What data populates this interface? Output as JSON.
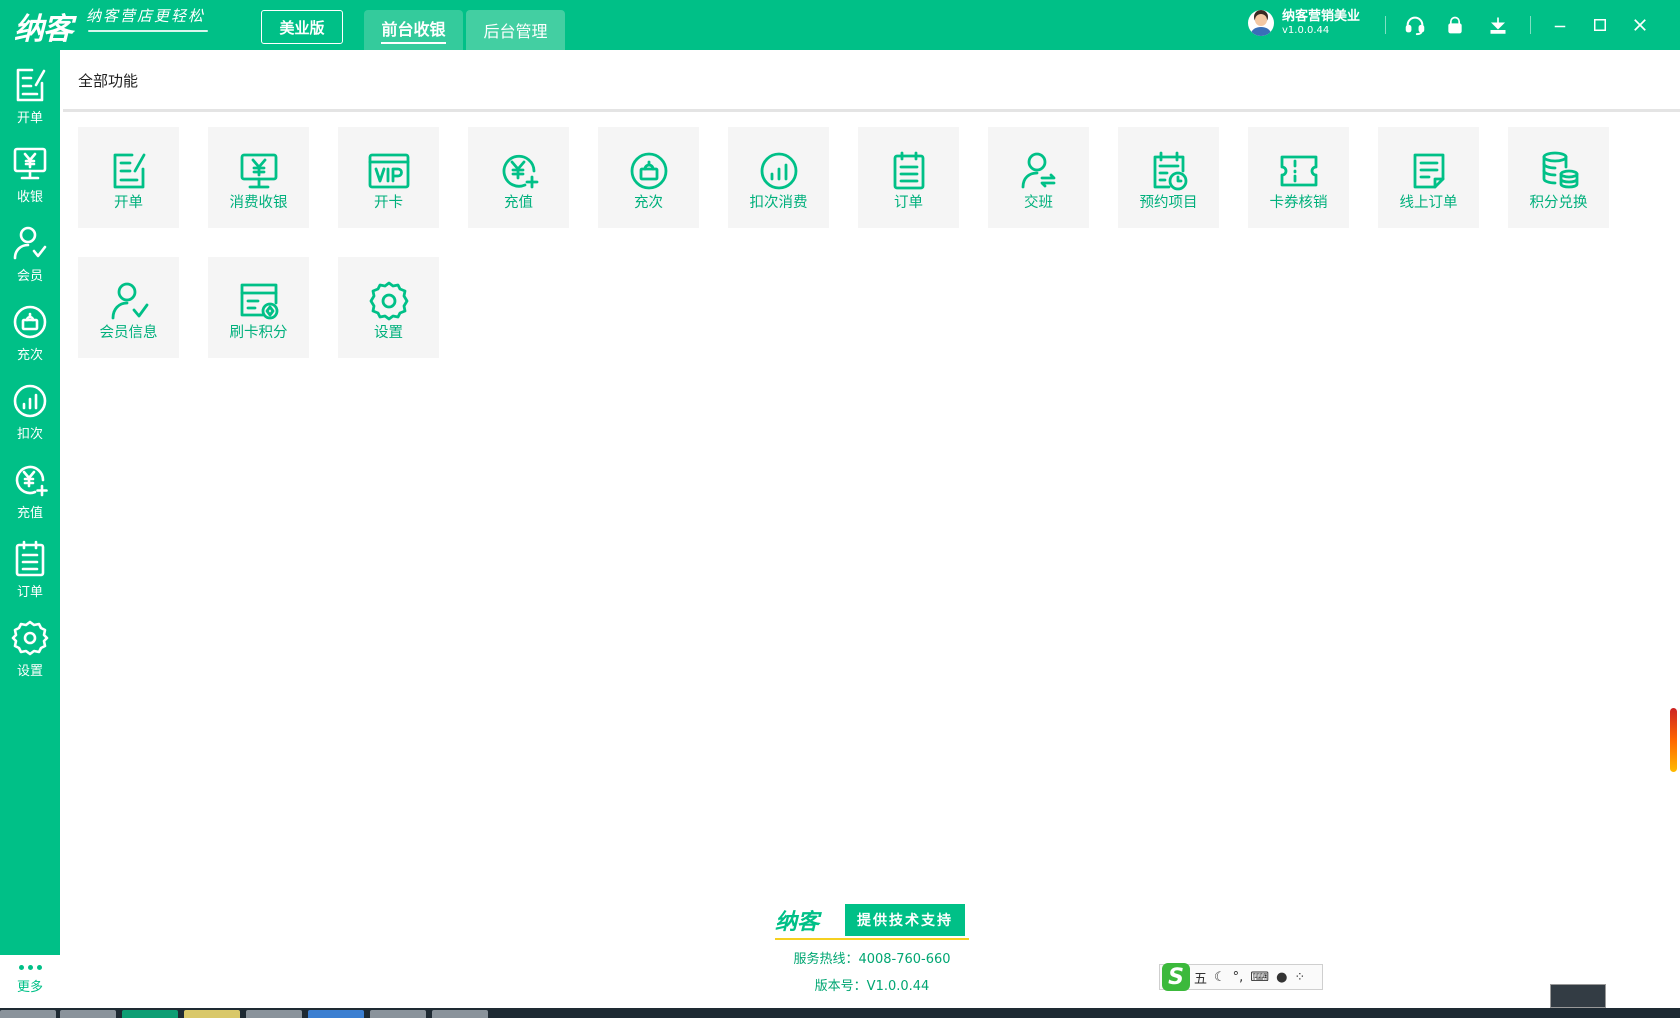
{
  "app": {
    "logo": "纳客",
    "slogan": "纳客营店更轻松",
    "edition": "美业版"
  },
  "top_tabs": [
    {
      "label": "前台收银",
      "active": true
    },
    {
      "label": "后台管理",
      "active": false
    }
  ],
  "user": {
    "name": "纳客营销美业",
    "version": "v1.0.0.44"
  },
  "top_icons": [
    "headset-icon",
    "lock-icon",
    "download-icon",
    "minimize-icon",
    "maximize-icon",
    "close-icon"
  ],
  "sidebar": {
    "items": [
      {
        "label": "开单",
        "icon": "edit-order-icon"
      },
      {
        "label": "收银",
        "icon": "cash-register-icon"
      },
      {
        "label": "会员",
        "icon": "member-icon"
      },
      {
        "label": "充次",
        "icon": "recharge-times-icon"
      },
      {
        "label": "扣次",
        "icon": "deduct-times-icon"
      },
      {
        "label": "充值",
        "icon": "recharge-icon"
      },
      {
        "label": "订单",
        "icon": "order-icon"
      },
      {
        "label": "设置",
        "icon": "settings-icon"
      }
    ],
    "more_label": "更多"
  },
  "main": {
    "title": "全部功能",
    "tiles": [
      {
        "label": "开单",
        "icon": "edit-order-icon"
      },
      {
        "label": "消费收银",
        "icon": "cash-register-icon"
      },
      {
        "label": "开卡",
        "icon": "vip-card-icon"
      },
      {
        "label": "充值",
        "icon": "recharge-icon"
      },
      {
        "label": "充次",
        "icon": "recharge-times-icon"
      },
      {
        "label": "扣次消费",
        "icon": "deduct-times-icon"
      },
      {
        "label": "订单",
        "icon": "order-icon"
      },
      {
        "label": "交班",
        "icon": "shift-handover-icon"
      },
      {
        "label": "预约项目",
        "icon": "appointment-icon"
      },
      {
        "label": "卡券核销",
        "icon": "coupon-icon"
      },
      {
        "label": "线上订单",
        "icon": "online-order-icon"
      },
      {
        "label": "积分兑换",
        "icon": "points-exchange-icon"
      },
      {
        "label": "会员信息",
        "icon": "member-info-icon"
      },
      {
        "label": "刷卡积分",
        "icon": "card-points-icon"
      },
      {
        "label": "设置",
        "icon": "settings-icon"
      }
    ]
  },
  "footer": {
    "logo": "纳客",
    "support": "提供技术支持",
    "hotline": "服务热线：4008-760-660",
    "version": "版本号：V1.0.0.44"
  },
  "ime": {
    "logo": "S",
    "mode": "五"
  },
  "colors": {
    "brand": "#00c087",
    "tile_bg": "#f5f5f5",
    "tile_text": "#00b07c"
  }
}
